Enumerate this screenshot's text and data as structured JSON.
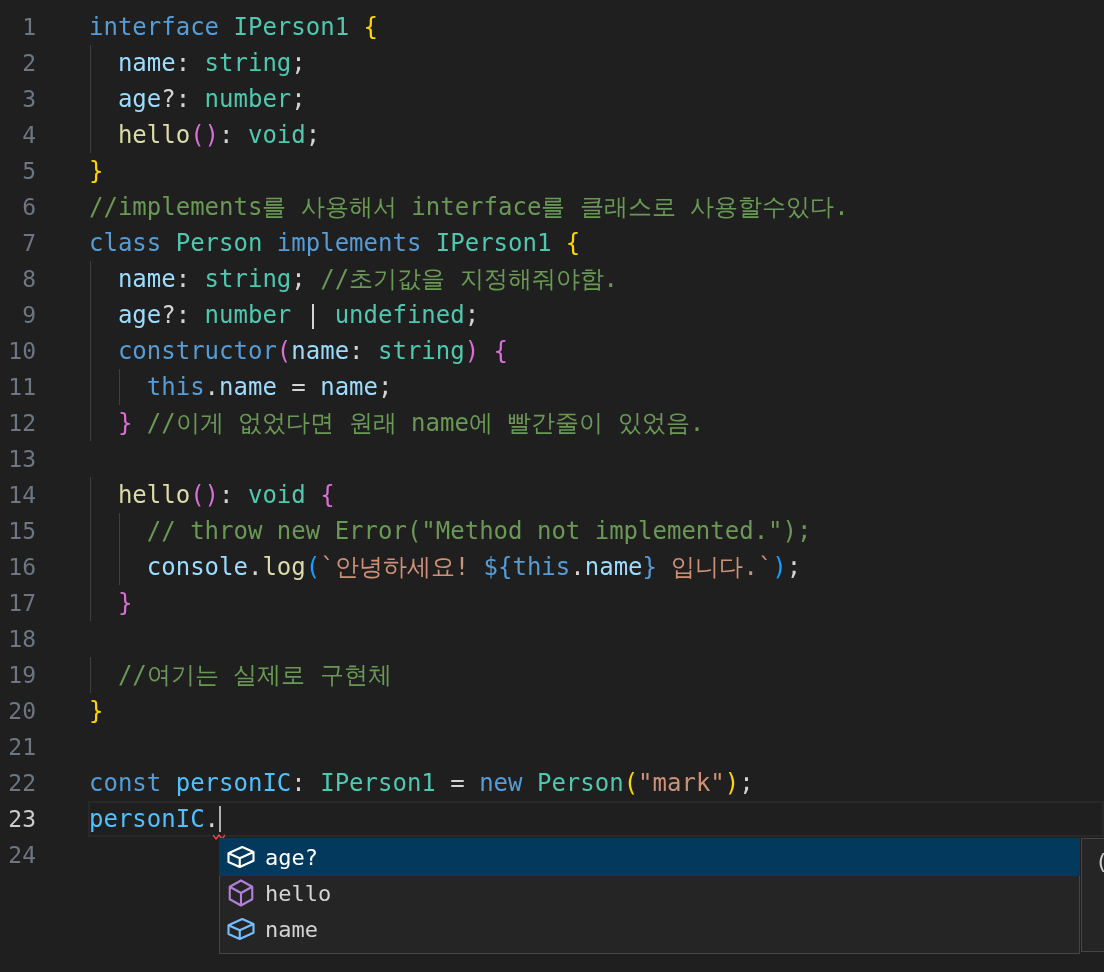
{
  "editor": {
    "lines": [
      {
        "number": "1",
        "current": false,
        "tokens": [
          {
            "kind": "kw",
            "text": "interface"
          },
          {
            "kind": "type",
            "text": " IPerson1"
          },
          {
            "kind": "b1",
            "text": " {"
          }
        ]
      },
      {
        "number": "2",
        "current": false,
        "tokens": [
          {
            "kind": "prop",
            "text": "  name"
          },
          {
            "kind": "p",
            "text": ":"
          },
          {
            "kind": "type",
            "text": " string"
          },
          {
            "kind": "p",
            "text": ";"
          }
        ]
      },
      {
        "number": "3",
        "current": false,
        "tokens": [
          {
            "kind": "prop",
            "text": "  age"
          },
          {
            "kind": "p",
            "text": "?:"
          },
          {
            "kind": "type",
            "text": " number"
          },
          {
            "kind": "p",
            "text": ";"
          }
        ]
      },
      {
        "number": "4",
        "current": false,
        "tokens": [
          {
            "kind": "func",
            "text": "  hello"
          },
          {
            "kind": "b2",
            "text": "()"
          },
          {
            "kind": "p",
            "text": ":"
          },
          {
            "kind": "type",
            "text": " void"
          },
          {
            "kind": "p",
            "text": ";"
          }
        ]
      },
      {
        "number": "5",
        "current": false,
        "tokens": [
          {
            "kind": "b1",
            "text": "}"
          }
        ]
      },
      {
        "number": "6",
        "current": false,
        "tokens": [
          {
            "kind": "com",
            "text": "//implements를 사용해서 interface를 클래스로 사용할수있다."
          }
        ]
      },
      {
        "number": "7",
        "current": false,
        "tokens": [
          {
            "kind": "kw",
            "text": "class"
          },
          {
            "kind": "type",
            "text": " Person"
          },
          {
            "kind": "kw",
            "text": " implements"
          },
          {
            "kind": "type",
            "text": " IPerson1"
          },
          {
            "kind": "b1",
            "text": " {"
          }
        ]
      },
      {
        "number": "8",
        "current": false,
        "tokens": [
          {
            "kind": "prop",
            "text": "  name"
          },
          {
            "kind": "p",
            "text": ":"
          },
          {
            "kind": "type",
            "text": " string"
          },
          {
            "kind": "p",
            "text": ";"
          },
          {
            "kind": "com",
            "text": " //초기값을 지정해줘야함."
          }
        ]
      },
      {
        "number": "9",
        "current": false,
        "tokens": [
          {
            "kind": "prop",
            "text": "  age"
          },
          {
            "kind": "p",
            "text": "?:"
          },
          {
            "kind": "type",
            "text": " number"
          },
          {
            "kind": "p",
            "text": " |"
          },
          {
            "kind": "type",
            "text": " undefined"
          },
          {
            "kind": "p",
            "text": ";"
          }
        ]
      },
      {
        "number": "10",
        "current": false,
        "tokens": [
          {
            "kind": "kw",
            "text": "  constructor"
          },
          {
            "kind": "b2",
            "text": "("
          },
          {
            "kind": "prop",
            "text": "name"
          },
          {
            "kind": "p",
            "text": ":"
          },
          {
            "kind": "type",
            "text": " string"
          },
          {
            "kind": "b2",
            "text": ")"
          },
          {
            "kind": "b2",
            "text": " {"
          }
        ]
      },
      {
        "number": "11",
        "current": false,
        "tokens": [
          {
            "kind": "kw",
            "text": "    this"
          },
          {
            "kind": "p",
            "text": "."
          },
          {
            "kind": "prop",
            "text": "name"
          },
          {
            "kind": "p",
            "text": " ="
          },
          {
            "kind": "prop",
            "text": " name"
          },
          {
            "kind": "p",
            "text": ";"
          }
        ]
      },
      {
        "number": "12",
        "current": false,
        "tokens": [
          {
            "kind": "b2",
            "text": "  }"
          },
          {
            "kind": "com",
            "text": " //이게 없었다면 원래 name에 빨간줄이 있었음."
          }
        ]
      },
      {
        "number": "13",
        "current": false
      },
      {
        "number": "14",
        "current": false,
        "tokens": [
          {
            "kind": "func",
            "text": "  hello"
          },
          {
            "kind": "b2",
            "text": "()"
          },
          {
            "kind": "p",
            "text": ":"
          },
          {
            "kind": "type",
            "text": " void"
          },
          {
            "kind": "b2",
            "text": " {"
          }
        ]
      },
      {
        "number": "15",
        "current": false,
        "tokens": [
          {
            "kind": "com",
            "text": "    // throw new Error(\"Method not implemented.\");"
          }
        ]
      },
      {
        "number": "16",
        "current": false,
        "tokens": [
          {
            "kind": "prop",
            "text": "    console"
          },
          {
            "kind": "p",
            "text": "."
          },
          {
            "kind": "func",
            "text": "log"
          },
          {
            "kind": "b3",
            "text": "("
          },
          {
            "kind": "str",
            "text": "`안녕하세요!"
          },
          {
            "kind": "kw",
            "text": " ${this"
          },
          {
            "kind": "p",
            "text": "."
          },
          {
            "kind": "prop",
            "text": "name"
          },
          {
            "kind": "kw",
            "text": "}"
          },
          {
            "kind": "str",
            "text": " 입니다.`"
          },
          {
            "kind": "b3",
            "text": ")"
          },
          {
            "kind": "p",
            "text": ";"
          }
        ]
      },
      {
        "number": "17",
        "current": false,
        "tokens": [
          {
            "kind": "b2",
            "text": "  }"
          }
        ]
      },
      {
        "number": "18",
        "current": false
      },
      {
        "number": "19",
        "current": false,
        "tokens": [
          {
            "kind": "com",
            "text": "  //여기는 실제로 구현체"
          }
        ]
      },
      {
        "number": "20",
        "current": false,
        "tokens": [
          {
            "kind": "b1",
            "text": "}"
          }
        ]
      },
      {
        "number": "21",
        "current": false
      },
      {
        "number": "22",
        "current": false,
        "tokens": [
          {
            "kind": "kw",
            "text": "const"
          },
          {
            "kind": "var",
            "text": " personIC"
          },
          {
            "kind": "p",
            "text": ":"
          },
          {
            "kind": "type",
            "text": " IPerson1"
          },
          {
            "kind": "p",
            "text": " ="
          },
          {
            "kind": "kw",
            "text": " new"
          },
          {
            "kind": "type",
            "text": " Person"
          },
          {
            "kind": "b1",
            "text": "("
          },
          {
            "kind": "str",
            "text": "\"mark\""
          },
          {
            "kind": "b1",
            "text": ")"
          },
          {
            "kind": "p",
            "text": ";"
          }
        ]
      },
      {
        "number": "23",
        "current": true,
        "tokens": [
          {
            "kind": "var",
            "text": "personIC"
          },
          {
            "kind": "p",
            "text": "."
          }
        ]
      },
      {
        "number": "24",
        "current": false
      }
    ]
  },
  "suggestions": {
    "items": [
      {
        "label": "age?",
        "kind": "property",
        "selected": true
      },
      {
        "label": "hello",
        "kind": "method",
        "selected": false
      },
      {
        "label": "name",
        "kind": "property",
        "selected": false
      }
    ],
    "details": [
      "("
    ]
  }
}
